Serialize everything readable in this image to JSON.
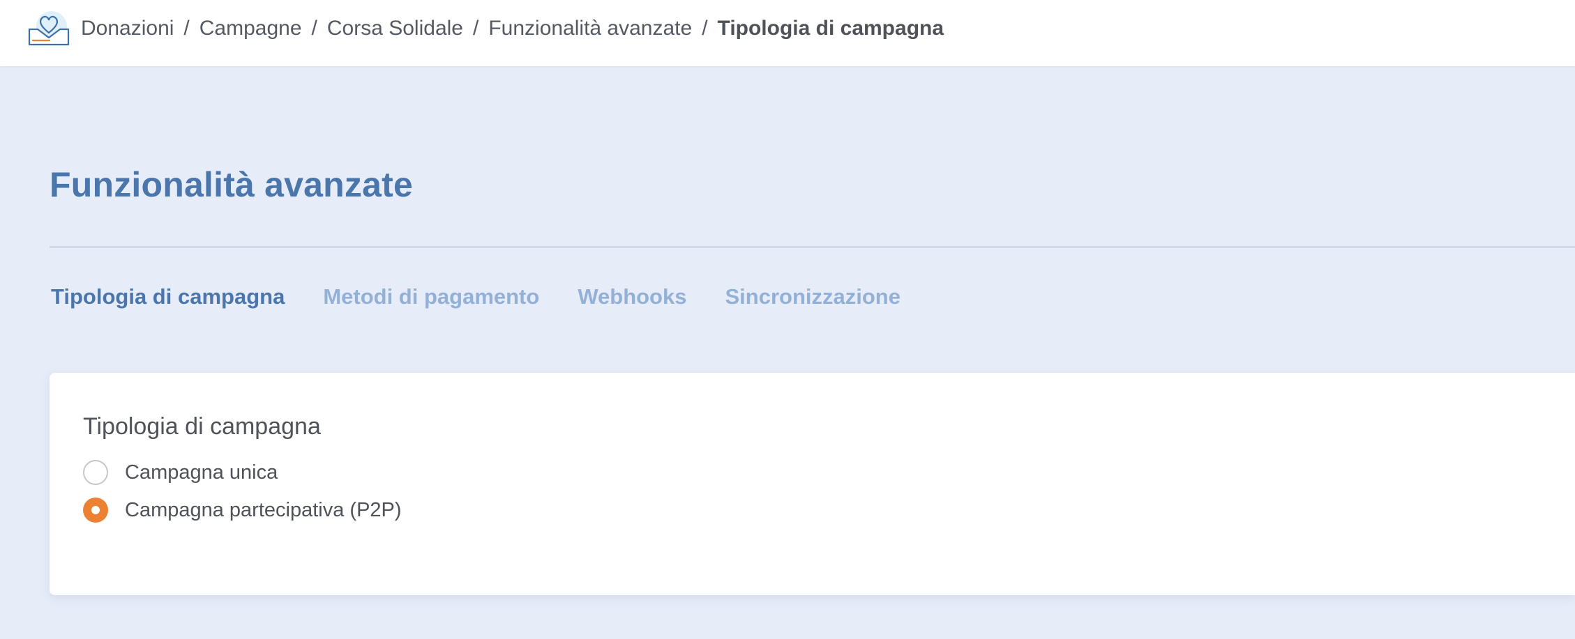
{
  "breadcrumb": {
    "items": [
      "Donazioni",
      "Campagne",
      "Corsa Solidale",
      "Funzionalità avanzate"
    ],
    "current": "Tipologia di campagna",
    "separator": "/"
  },
  "logo": {
    "icon": "heart-in-box-icon",
    "colors": {
      "stroke": "#3f6fa8",
      "accent": "#ec8133",
      "halo": "#dff0fb"
    }
  },
  "page": {
    "title": "Funzionalità avanzate"
  },
  "tabs": [
    {
      "label": "Tipologia di campagna",
      "active": true
    },
    {
      "label": "Metodi di pagamento",
      "active": false
    },
    {
      "label": "Webhooks",
      "active": false
    },
    {
      "label": "Sincronizzazione",
      "active": false
    }
  ],
  "campaign_type": {
    "title": "Tipologia di campagna",
    "options": [
      {
        "label": "Campagna unica",
        "selected": false
      },
      {
        "label": "Campagna partecipativa (P2P)",
        "selected": true
      }
    ]
  },
  "colors": {
    "background": "#e6ecf8",
    "title_blue": "#4a76ac",
    "tab_inactive": "#93b0d6",
    "radio_selected": "#ec8133"
  }
}
